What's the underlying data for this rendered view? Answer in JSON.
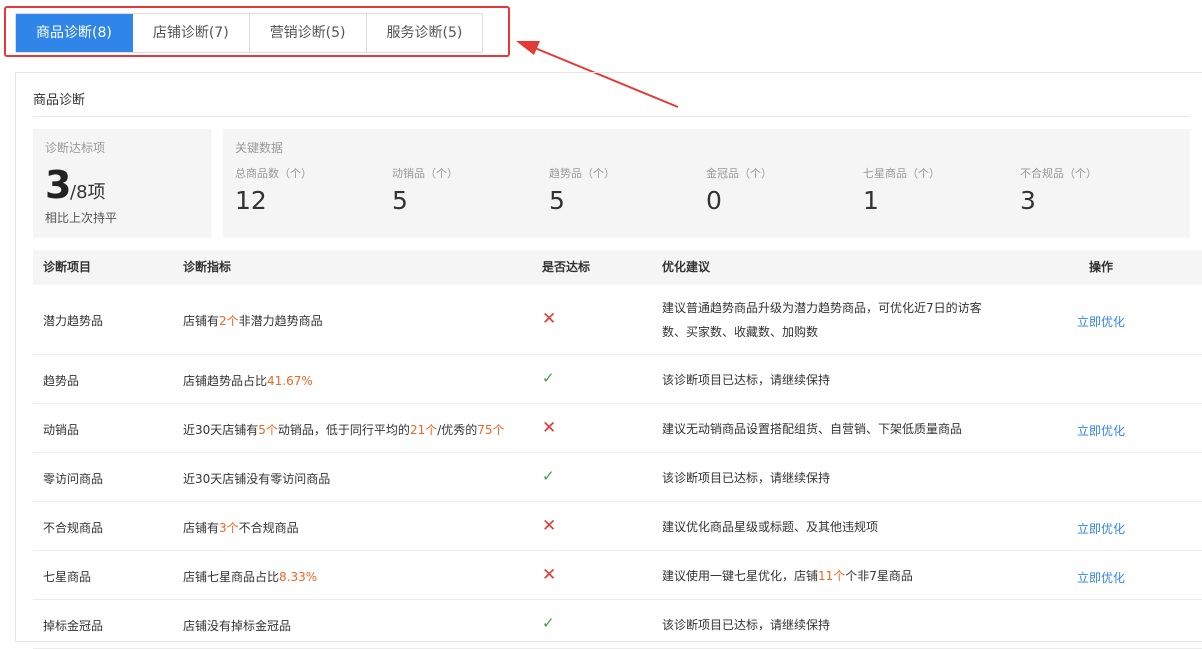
{
  "tabs": [
    {
      "label": "商品诊断(8)",
      "active": true
    },
    {
      "label": "店铺诊断(7)",
      "active": false
    },
    {
      "label": "营销诊断(5)",
      "active": false
    },
    {
      "label": "服务诊断(5)",
      "active": false
    }
  ],
  "annotation_color": "#e53935",
  "panel": {
    "title": "商品诊断",
    "summary": {
      "label": "诊断达标项",
      "value": "3",
      "total": "/8项",
      "compare": "相比上次持平"
    },
    "key_data": {
      "label": "关键数据",
      "metrics": [
        {
          "label": "总商品数（个）",
          "value": "12"
        },
        {
          "label": "动销品（个）",
          "value": "5"
        },
        {
          "label": "趋势品（个）",
          "value": "5"
        },
        {
          "label": "金冠品（个）",
          "value": "0"
        },
        {
          "label": "七星商品（个）",
          "value": "1"
        },
        {
          "label": "不合规品（个）",
          "value": "3"
        }
      ]
    },
    "table": {
      "headers": {
        "item": "诊断项目",
        "metric": "诊断指标",
        "pass": "是否达标",
        "suggestion": "优化建议",
        "action": "操作"
      },
      "rows": [
        {
          "item": "潜力趋势品",
          "metric": [
            {
              "t": "店铺有"
            },
            {
              "t": "2个",
              "h": true
            },
            {
              "t": "非潜力趋势商品"
            }
          ],
          "pass": false,
          "suggestion": [
            [
              {
                "t": "建议普通趋势商品升级为潜力趋势商品，可优化近7日的访客"
              }
            ],
            [
              {
                "t": "数、买家数、收藏数、加购数"
              }
            ]
          ],
          "action": "立即优化"
        },
        {
          "item": "趋势品",
          "metric": [
            {
              "t": "店铺趋势品占比"
            },
            {
              "t": "41.67%",
              "h": true
            }
          ],
          "pass": true,
          "suggestion": [
            [
              {
                "t": "该诊断项目已达标，请继续保持"
              }
            ]
          ],
          "action": ""
        },
        {
          "item": "动销品",
          "metric": [
            {
              "t": "近30天店铺有"
            },
            {
              "t": "5个",
              "h": true
            },
            {
              "t": "动销品，低于同行平均的"
            },
            {
              "t": "21个",
              "h": true
            },
            {
              "t": "/优秀的"
            },
            {
              "t": "75个",
              "h": true
            }
          ],
          "pass": false,
          "suggestion": [
            [
              {
                "t": "建议无动销商品设置搭配组货、自营销、下架低质量商品"
              }
            ]
          ],
          "action": "立即优化"
        },
        {
          "item": "零访问商品",
          "metric": [
            {
              "t": "近30天店铺没有零访问商品"
            }
          ],
          "pass": true,
          "suggestion": [
            [
              {
                "t": "该诊断项目已达标，请继续保持"
              }
            ]
          ],
          "action": ""
        },
        {
          "item": "不合规商品",
          "metric": [
            {
              "t": "店铺有"
            },
            {
              "t": "3个",
              "h": true
            },
            {
              "t": "不合规商品"
            }
          ],
          "pass": false,
          "suggestion": [
            [
              {
                "t": "建议优化商品星级或标题、及其他违规项"
              }
            ]
          ],
          "action": "立即优化"
        },
        {
          "item": "七星商品",
          "metric": [
            {
              "t": "店铺七星商品占比"
            },
            {
              "t": "8.33%",
              "h": true
            }
          ],
          "pass": false,
          "suggestion": [
            [
              {
                "t": "建议使用一键七星优化，店铺"
              },
              {
                "t": "11个",
                "h": true
              },
              {
                "t": "个非7星商品"
              }
            ]
          ],
          "action": "立即优化"
        },
        {
          "item": "掉标金冠品",
          "metric": [
            {
              "t": "店铺没有掉标金冠品"
            }
          ],
          "pass": true,
          "suggestion": [
            [
              {
                "t": "该诊断项目已达标，请继续保持"
              }
            ]
          ],
          "action": ""
        }
      ]
    }
  }
}
